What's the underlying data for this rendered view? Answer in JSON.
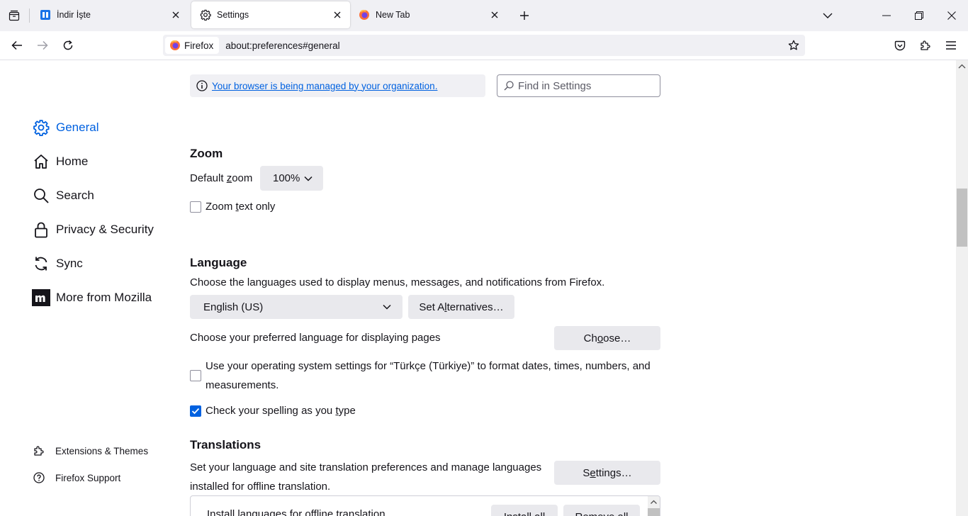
{
  "tabs": [
    {
      "title": "İndir İşte",
      "favicon": "indir-favicon"
    },
    {
      "title": "Settings",
      "favicon": "gear-icon",
      "active": true
    },
    {
      "title": "New Tab",
      "favicon": "firefox-icon"
    }
  ],
  "navbar": {
    "identity_label": "Firefox",
    "url": "about:preferences#general"
  },
  "policy_notice": "Your browser is being managed by your organization.",
  "search": {
    "placeholder": "Find in Settings"
  },
  "sidebar": {
    "categories": [
      {
        "label": "General",
        "icon": "gear-icon",
        "selected": true
      },
      {
        "label": "Home",
        "icon": "home-icon"
      },
      {
        "label": "Search",
        "icon": "search-icon"
      },
      {
        "label": "Privacy & Security",
        "icon": "lock-icon"
      },
      {
        "label": "Sync",
        "icon": "sync-icon"
      },
      {
        "label": "More from Mozilla",
        "icon": "mozilla-icon"
      }
    ],
    "footer": [
      {
        "label": "Extensions & Themes",
        "icon": "puzzle-icon"
      },
      {
        "label": "Firefox Support",
        "icon": "help-icon"
      }
    ]
  },
  "zoom": {
    "heading": "Zoom",
    "default_zoom_label": "Default zoom",
    "default_zoom_value": "100%",
    "text_only_label": "Zoom text only",
    "text_only_checked": false
  },
  "language": {
    "heading": "Language",
    "description": "Choose the languages used to display menus, messages, and notifications from Firefox.",
    "selected_language": "English (US)",
    "set_alternatives": "Set Alternatives…",
    "pages_label": "Choose your preferred language for displaying pages",
    "choose_button": "Choose…",
    "os_settings_label_line1": "Use your operating system settings for “Türkçe (Türkiye)” to format dates, times, numbers, and",
    "os_settings_label_line2": "measurements.",
    "os_settings_checked": false,
    "spellcheck_label": "Check your spelling as you type",
    "spellcheck_checked": true
  },
  "translations": {
    "heading": "Translations",
    "description_line1": "Set your language and site translation preferences and manage languages",
    "description_line2": "installed for offline translation.",
    "settings_button": "Settings…",
    "install_label": "Install languages for offline translation",
    "install_all": "Install all",
    "remove_all": "Remove all"
  },
  "colors": {
    "accent": "#0061e0",
    "tabstrip": "#f0f0f4",
    "button": "#e9e9ed"
  }
}
